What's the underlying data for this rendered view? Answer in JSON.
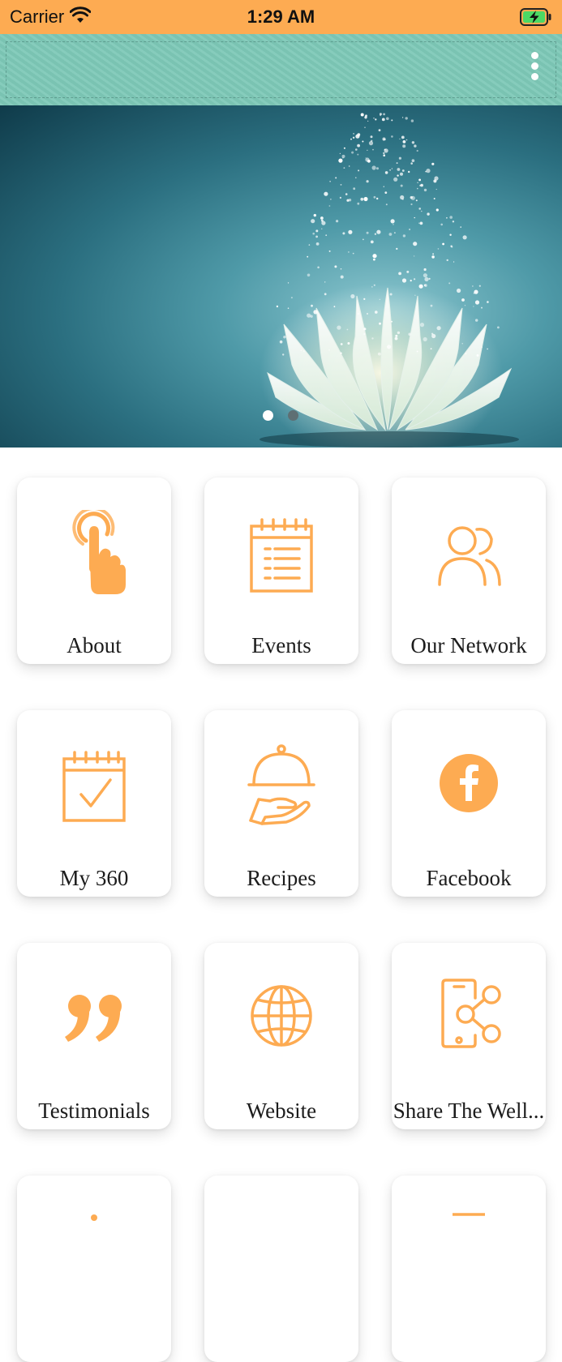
{
  "status_bar": {
    "carrier": "Carrier",
    "time": "1:29 AM",
    "wifi_icon": "wifi-icon",
    "battery_icon": "battery-charging-icon"
  },
  "nav_bar": {
    "background_color": "#7ec9b8",
    "menu_icon": "more-vertical-icon"
  },
  "banner": {
    "image": "white lotus with sparkles on teal background",
    "slide_count": 2,
    "active_slide": 1
  },
  "colors": {
    "accent": "#fdab52",
    "status_bar": "#fdab52",
    "tile_background": "#ffffff"
  },
  "tiles": [
    {
      "label": "About",
      "icon": "tap-finger-icon"
    },
    {
      "label": "Events",
      "icon": "events-list-icon"
    },
    {
      "label": "Our Network",
      "icon": "users-icon"
    },
    {
      "label": "My 360",
      "icon": "calendar-check-icon"
    },
    {
      "label": "Recipes",
      "icon": "serving-dish-icon"
    },
    {
      "label": "Facebook",
      "icon": "facebook-icon"
    },
    {
      "label": "Testimonials",
      "icon": "quote-icon"
    },
    {
      "label": "Website",
      "icon": "globe-icon"
    },
    {
      "label": "Share The Well...",
      "icon": "phone-share-icon"
    }
  ]
}
